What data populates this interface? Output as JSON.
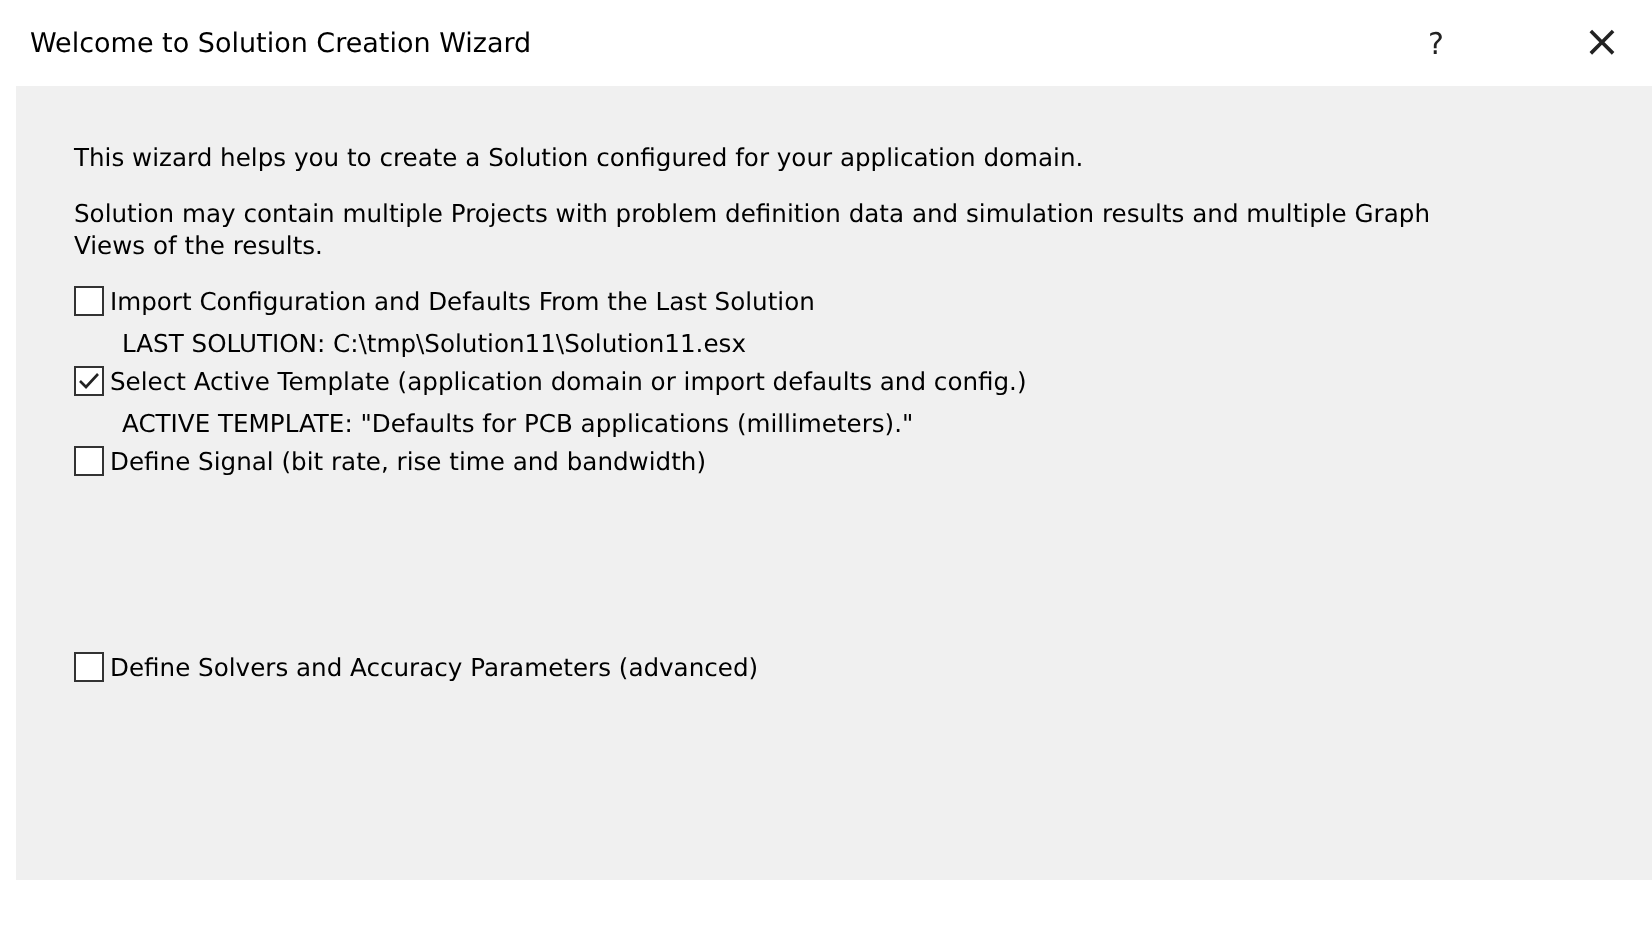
{
  "window": {
    "title": "Welcome to Solution Creation Wizard",
    "help": "?",
    "close": "×"
  },
  "intro": [
    "This wizard helps you to create a Solution configured for your application domain.",
    "Solution may contain multiple Projects with problem definition data and simulation results and multiple Graph Views of the results."
  ],
  "options": [
    {
      "label": "Import Configuration and Defaults From the Last Solution",
      "checked": false,
      "detail": "LAST SOLUTION: C:\\tmp\\Solution11\\Solution11.esx"
    },
    {
      "label": "Select Active Template (application domain or import defaults and config.)",
      "checked": true,
      "detail": "ACTIVE TEMPLATE: \"Defaults for PCB applications (millimeters).\""
    },
    {
      "label": "Define Signal (bit rate, rise time and bandwidth)",
      "checked": false
    },
    {
      "label": "Define Solvers and Accuracy Parameters (advanced)",
      "checked": false
    }
  ]
}
